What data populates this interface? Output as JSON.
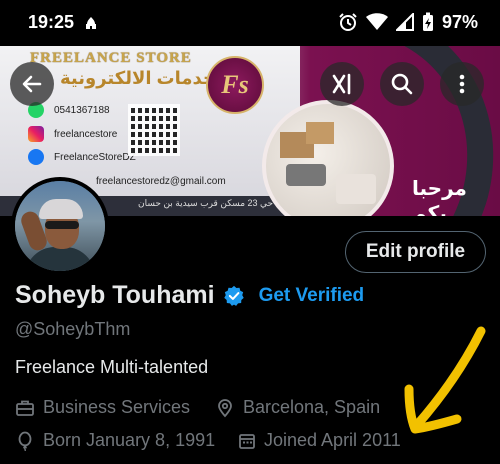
{
  "status_bar": {
    "time": "19:25",
    "battery": "97%",
    "icons": [
      "mosque-icon",
      "alarm-icon",
      "wifi-icon",
      "signal-icon",
      "battery-icon"
    ]
  },
  "banner": {
    "store_title": "FREELANCE STORE",
    "arabic_title": "الخدمات الالكترونية",
    "logo_text": "Fs",
    "contacts": [
      {
        "icon": "whatsapp-icon",
        "text": "0541367188"
      },
      {
        "icon": "instagram-icon",
        "text": "freelancestore"
      },
      {
        "icon": "facebook-icon",
        "text": "FreelanceStoreDZ"
      },
      {
        "icon": "email-icon",
        "text": "freelancestoredz@gmail.com"
      }
    ],
    "address": "حي 23 مسكن قرب سيدية بن حسان",
    "welcome": "مرحبا بكم"
  },
  "nav": {
    "back": "back-arrow-icon",
    "grok": "grok-icon",
    "search": "search-icon",
    "more": "more-vertical-icon"
  },
  "profile": {
    "edit_label": "Edit profile",
    "name": "Soheyb Touhami",
    "get_verified": "Get Verified",
    "handle": "@SoheybThm",
    "bio": "Freelance Multi-talented",
    "category": "Business Services",
    "location": "Barcelona, Spain",
    "born": "Born January 8, 1991",
    "joined": "Joined April 2011"
  },
  "colors": {
    "accent": "#1d9bf0",
    "muted": "#71767b",
    "text": "#e7e9ea",
    "annotation_arrow": "#f2c100"
  }
}
